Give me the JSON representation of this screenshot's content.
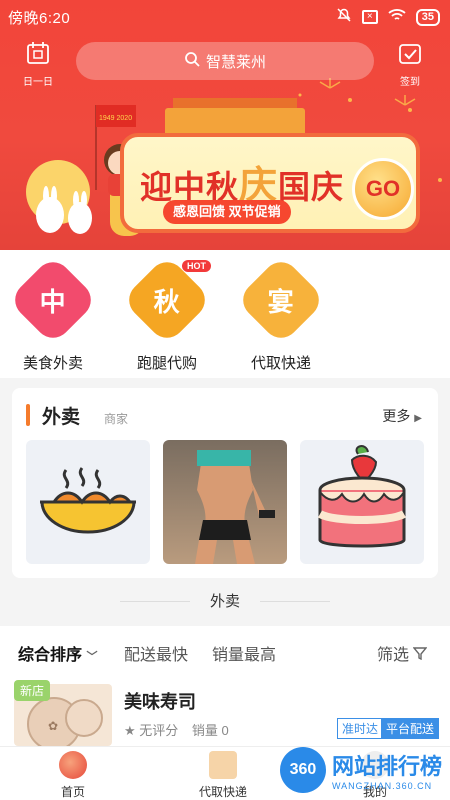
{
  "status": {
    "time": "傍晚6:20",
    "battery": "35"
  },
  "header": {
    "calendar_label": "日一日",
    "search_placeholder": "智慧莱州",
    "checkin_label": "签到"
  },
  "banner": {
    "title_1": "迎中秋",
    "title_2": "庆",
    "title_3": "国庆",
    "subtitle": "感恩回馈 双节促销",
    "go": "GO",
    "flag": "1949 2020"
  },
  "categories": [
    {
      "badge": "中",
      "name": "美食外卖",
      "color": "#f24b6d"
    },
    {
      "badge": "秋",
      "name": "跑腿代购",
      "color": "#f5a623",
      "hot": "HOT"
    },
    {
      "badge": "宴",
      "name": "代取快递",
      "color": "#f7b23b"
    }
  ],
  "takeout": {
    "title": "外卖",
    "subtitle": "商家",
    "more": "更多"
  },
  "section_label": "外卖",
  "sort": {
    "items": [
      "综合排序",
      "配送最快",
      "销量最高"
    ],
    "filter": "筛选"
  },
  "shop": {
    "badge": "新店",
    "name": "美味寿司",
    "rating": "无评分",
    "sales": "销量 0",
    "tag1": "准时达",
    "tag2": "平台配送"
  },
  "tabs": [
    {
      "label": "首页"
    },
    {
      "label": "代取快递"
    },
    {
      "label": "我的"
    }
  ],
  "watermark": {
    "badge": "360",
    "title": "网站排行榜",
    "url": "WANGZHAN.360.CN"
  }
}
